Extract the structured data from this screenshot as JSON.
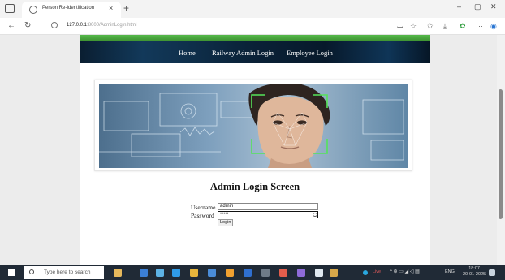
{
  "browser": {
    "tab_title": "Person Re-Identification",
    "tab_close": "×",
    "new_tab": "+",
    "url_host": "127.0.0.1",
    "url_path": ":8000/AdminLogin.html",
    "window_controls": [
      "–",
      "▢",
      "✕"
    ],
    "icons": [
      "back-icon",
      "refresh-icon",
      "info-icon",
      "favorite-icon",
      "collections-icon",
      "downloads-icon",
      "extensions-icon",
      "more-icon",
      "edge-copilot-icon"
    ]
  },
  "site": {
    "nav": [
      "Home",
      "Railway Admin Login",
      "Employee Login"
    ],
    "login_title": "Admin Login Screen",
    "username_label": "Username",
    "username_value": "admin",
    "password_label": "Password",
    "password_value": "•••••",
    "login_button": "Login"
  },
  "taskbar": {
    "search_placeholder": "Type here to search",
    "language": "ENG",
    "time": "18:07",
    "date": "20-01-2025",
    "live": "Live"
  },
  "colors": {
    "nav_background": "#0a2238",
    "top_bar": "#4caf42",
    "taskbar": "#202a36"
  }
}
